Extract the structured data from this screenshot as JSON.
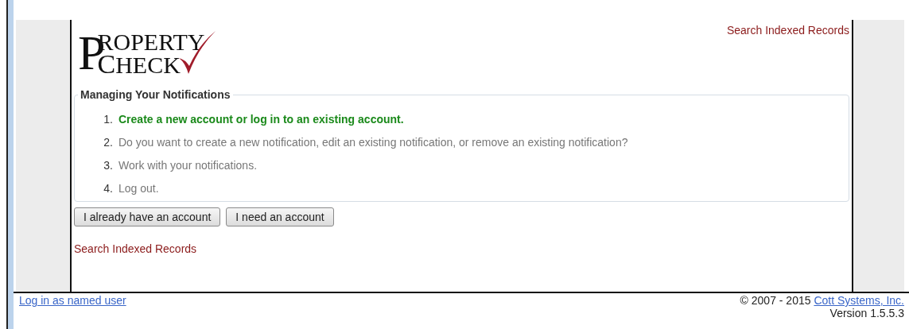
{
  "header": {
    "logo": {
      "big_letter": "P",
      "line_1": "ROPERTY",
      "line_2_initial": "C",
      "line_2": "HECK"
    },
    "top_link": "Search Indexed Records"
  },
  "panel": {
    "legend": "Managing Your Notifications",
    "steps": [
      {
        "number": "1.",
        "text": "Create a new account or log in to an existing account.",
        "selected": true
      },
      {
        "number": "2.",
        "text": "Do you want to create a new notification, edit an existing notification, or remove an existing notification?",
        "selected": false
      },
      {
        "number": "3.",
        "text": "Work with your notifications.",
        "selected": false
      },
      {
        "number": "4.",
        "text": "Log out.",
        "selected": false
      }
    ]
  },
  "buttons": [
    "I already have an account",
    "I need an account"
  ],
  "bottom_link": "Search Indexed Records",
  "footer": {
    "login_link": "Log in as named user",
    "copyright": "© 2007 - 2015",
    "company_link": "Cott Systems, Inc.",
    "version": "Version 1.5.5.3"
  }
}
